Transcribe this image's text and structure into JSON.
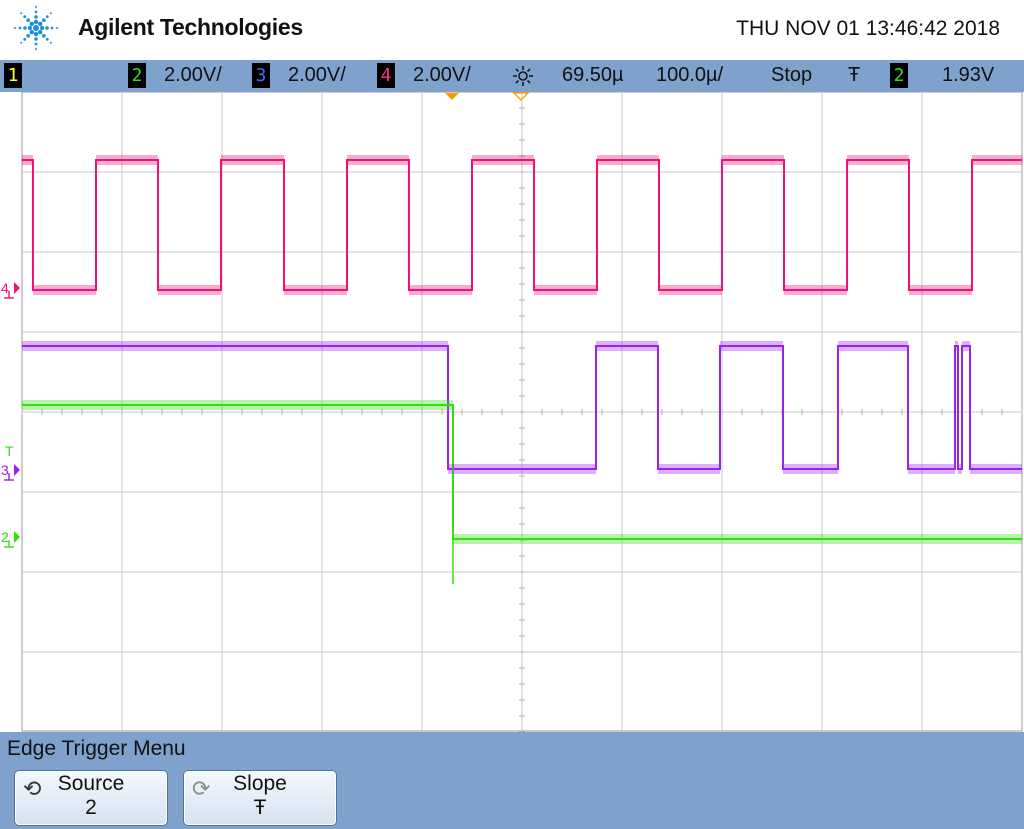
{
  "header": {
    "brand": "Agilent Technologies",
    "datetime": "THU NOV 01 13:46:42 2018"
  },
  "status": {
    "ch1": "1",
    "ch2": "2",
    "ch2_scale": "2.00V/",
    "ch3": "3",
    "ch3_scale": "2.00V/",
    "ch4": "4",
    "ch4_scale": "2.00V/",
    "delay": "69.50µ",
    "timebase": "100.0µ/",
    "run_state": "Stop",
    "trigger_slope_symbol": "Ŧ",
    "trigger_channel": "2",
    "trigger_level": "1.93V"
  },
  "markers": {
    "ch4": "4",
    "ch3": "3",
    "ch2": "2",
    "trigger": "T"
  },
  "colors": {
    "ch2": "#33dd11",
    "ch3": "#9922ee",
    "ch4": "#ee1177",
    "accent": "#7fa2cc",
    "trigger_marker": "#ff9900"
  },
  "icons": {
    "logo": "agilent-spark-icon",
    "delay": "delay-sun-icon",
    "source_softkey": "rotate-knob-icon",
    "slope_softkey": "rotate-knob-icon"
  },
  "menu": {
    "title": "Edge Trigger Menu",
    "source": {
      "label": "Source",
      "value": "2"
    },
    "slope": {
      "label": "Slope",
      "value": "Ŧ"
    }
  },
  "waveforms": {
    "ch4_transitions": [
      33,
      96,
      158,
      221,
      284,
      347,
      409,
      472,
      534,
      597,
      659,
      722,
      784,
      847,
      909,
      972
    ],
    "ch4_initial": "high",
    "ch3_transitions": [
      448,
      596,
      658,
      720,
      783,
      838,
      908,
      955,
      958,
      962,
      970
    ],
    "ch3_initial": "high",
    "ch2_transitions": [
      453
    ],
    "ch2_initial": "high"
  }
}
